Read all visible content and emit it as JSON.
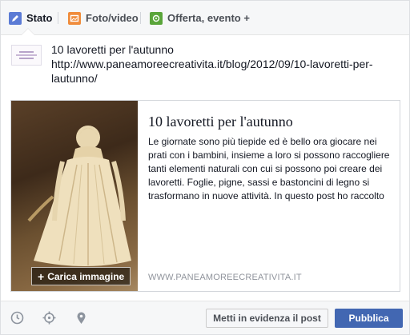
{
  "tabs": {
    "status": "Stato",
    "photo": "Foto/video",
    "offer": "Offerta, evento +"
  },
  "post": {
    "lines": [
      "10 lavoretti per l'autunno",
      "http://www.paneamoreecreativita.it/blog/2012/09/10-lavoretti-per-",
      "lautunno/"
    ]
  },
  "preview": {
    "title": "10 lavoretti per l'autunno",
    "description_lines": [
      "Le giornate sono più tiepide ed è bello ora giocare nei",
      "prati con i bambini, insieme a loro si possono raccogliere",
      "tanti elementi naturali con cui si possono poi creare dei",
      "lavoretti. Foglie, pigne, sassi e bastoncini di legno si",
      "trasformano in nuove attività. In questo post ho raccolto"
    ],
    "domain": "WWW.PANEAMOREECREATIVITA.IT",
    "upload_label": "Carica immagine"
  },
  "footer": {
    "feature_label": "Metti in evidenza il post",
    "publish_label": "Pubblica",
    "icons": [
      "clock-icon",
      "target-icon",
      "location-pin-icon"
    ]
  },
  "colors": {
    "primary": "#4267b2",
    "tab_bar": "#f6f7f8",
    "status_icon": "#5b7bd5",
    "photo_icon": "#f08c3c",
    "offer_icon": "#5aa53a"
  }
}
